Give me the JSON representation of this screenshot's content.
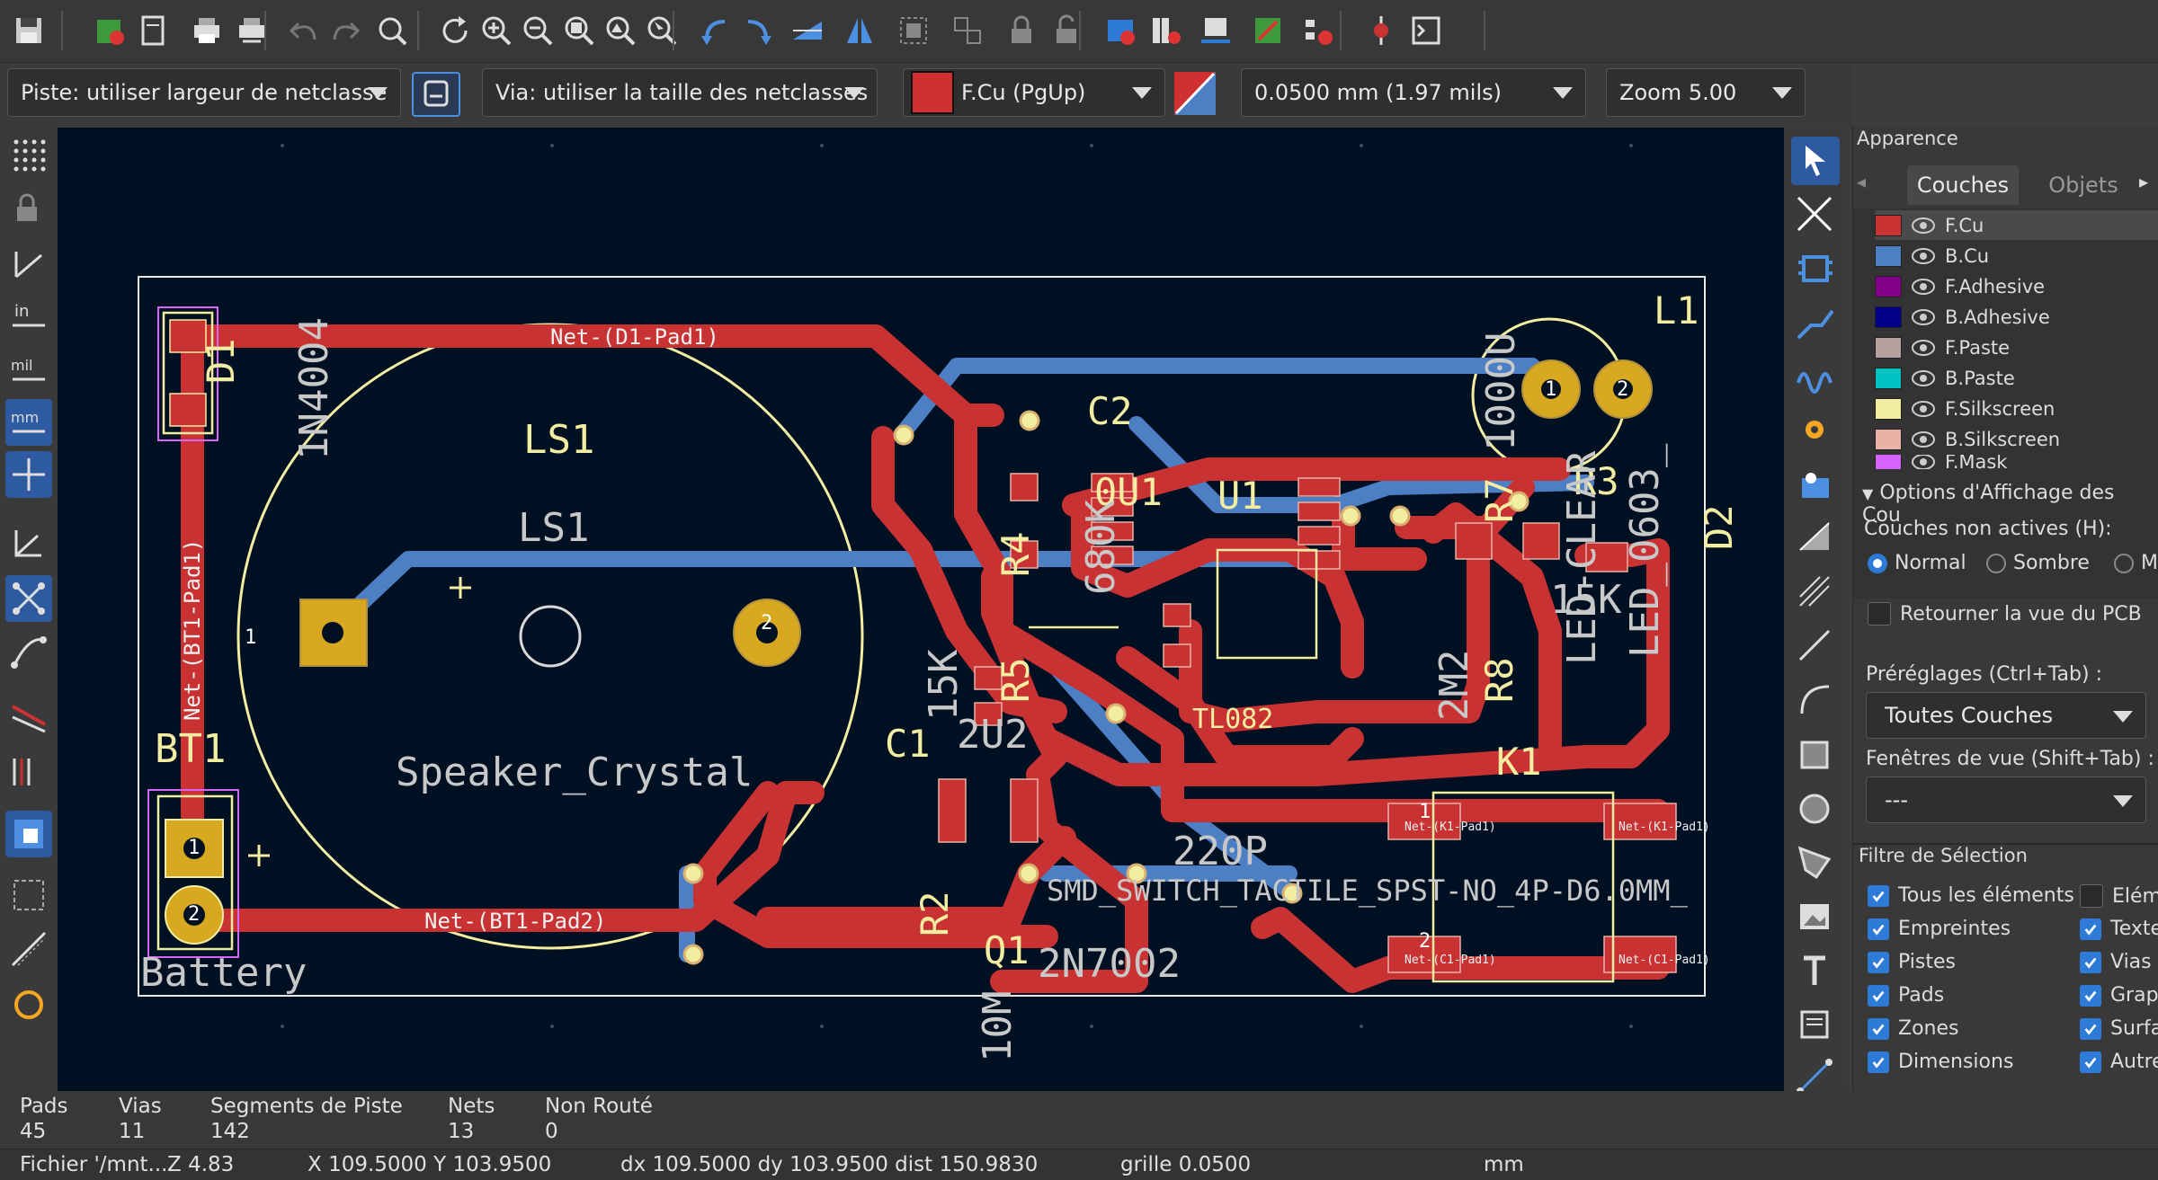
{
  "app": "KiCad PCB Editor",
  "aux_toolbar": {
    "track_width": "Piste: utiliser largeur de netclasse",
    "via_size": "Via: utiliser la taille des netclasses",
    "layer": "F.Cu (PgUp)",
    "grid": "0.0500 mm (1.97 mils)",
    "zoom": "Zoom 5.00",
    "colors": {
      "active_layer": "#d03030",
      "accent": "#2d5aa0"
    }
  },
  "top_toolbar_icons": [
    "save-icon",
    "board-setup-icon",
    "page-settings-icon",
    "print-icon",
    "plot-icon",
    "undo-icon",
    "redo-icon",
    "find-icon",
    "refresh-icon",
    "zoom-in-icon",
    "zoom-out-icon",
    "zoom-fit-icon",
    "zoom-objects-icon",
    "zoom-selection-icon",
    "rotate-ccw-icon",
    "rotate-cw-icon",
    "flip-icon",
    "mirror-icon",
    "group-icon",
    "ungroup-icon",
    "lock-icon",
    "unlock-icon",
    "netlist-icon",
    "footprint-library-icon",
    "footprint-editor-icon",
    "scripting-icon",
    "drc-icon",
    "update-pcb-icon",
    "scripting-console-icon"
  ],
  "left_toolbar_icons": [
    "grid-dots-icon",
    "lock-icon",
    "angle-icon",
    "inch-units-icon",
    "mil-units-icon",
    "mm-units-icon",
    "cursor-crosshair-icon",
    "polar-coords-icon",
    "ratsnest-icon",
    "curved-ratsnest-icon",
    "net-color-icon",
    "layer-colors-icon",
    "high-contrast-icon",
    "outline-zones-icon",
    "tracks-outline-icon",
    "pads-outline-icon"
  ],
  "right_toolbar_icons": [
    "select-icon",
    "highlight-net-icon",
    "footprint-add-icon",
    "route-track-icon",
    "route-diff-pair-icon",
    "tune-length-icon",
    "add-via-icon",
    "add-zone-icon",
    "add-rule-area-icon",
    "draw-line-icon",
    "draw-arc-icon",
    "draw-rectangle-icon",
    "draw-circle-icon",
    "draw-polygon-icon",
    "add-image-icon",
    "add-text-icon",
    "add-textbox-icon",
    "add-dimension-icon"
  ],
  "pcb": {
    "net_labels": {
      "d1": "Net-(D1-Pad1)",
      "bt1_pad2": "Net-(BT1-Pad2)",
      "bt1_pad1": "Net-(BT1-Pad1)",
      "k1_pad1": "Net-(K1-Pad1)",
      "c1_pad1": "Net-(C1-Pad1)"
    },
    "ref_labels": {
      "ls1": "LS1",
      "ls1_back": "LS1",
      "speaker": "Speaker_Crystal",
      "battery": "Battery",
      "bt1": "BT1",
      "d1": "D1",
      "d1_val": "1N4004",
      "c2": "C2",
      "u1": "U1",
      "l1": "L1",
      "r3": "R3",
      "d2": "D2",
      "c1": "C1",
      "k1": "K1",
      "q1": "Q1",
      "tl082": "TL082",
      "q1_val": "2N7002",
      "switch": "SMD_SWITCH_TACTILE_SPST-NO_4P-D6.0MM_",
      "val_15k_a": "15K",
      "val_15k_b": "15K",
      "val_1000u": "1000U",
      "val_0u1": "0U1",
      "val_2m2": "2M2",
      "val_2u2": "2U2",
      "val_220p": "220P",
      "val_10m": "10M",
      "r4": "R4",
      "r5": "R5",
      "r7": "R7",
      "r8": "R8",
      "r2": "R2",
      "led": "LED_0603_",
      "led_clear": "LED-CLEAR",
      "k680": "680K"
    },
    "pad_numbers": [
      "1",
      "2"
    ]
  },
  "panel": {
    "title": "Apparence",
    "tab_layers": "Couches",
    "tab_objects": "Objets",
    "layers": [
      {
        "name": "F.Cu",
        "color": "#c83232"
      },
      {
        "name": "B.Cu",
        "color": "#4d7fc4"
      },
      {
        "name": "F.Adhesive",
        "color": "#84008a"
      },
      {
        "name": "B.Adhesive",
        "color": "#00008a"
      },
      {
        "name": "F.Paste",
        "color": "#b4a09c"
      },
      {
        "name": "B.Paste",
        "color": "#00c2c2"
      },
      {
        "name": "F.Silkscreen",
        "color": "#f2eda1"
      },
      {
        "name": "B.Silkscreen",
        "color": "#e8b2a7"
      },
      {
        "name": "F.Mask",
        "color": "#d864ff"
      }
    ],
    "display_options": "Options d'Affichage des Cou",
    "inactive_layers": "Couches non actives (H):",
    "radio_normal": "Normal",
    "radio_dim": "Sombre",
    "radio_hide": "M",
    "flip_view": "Retourner la vue du PCB",
    "presets_label": "Préréglages (Ctrl+Tab) :",
    "presets_value": "Toutes Couches",
    "viewports_label": "Fenêtres de vue (Shift+Tab) :",
    "viewports_value": "---",
    "selection_filter": "Filtre de Sélection",
    "filters_left": [
      "Tous les éléments",
      "Empreintes",
      "Pistes",
      "Pads",
      "Zones",
      "Dimensions"
    ],
    "filters_right": [
      "Eléme",
      "Texte",
      "Vias",
      "Graph",
      "Surfa",
      "Autre"
    ]
  },
  "stats": {
    "pads_label": "Pads",
    "pads": "45",
    "vias_label": "Vias",
    "vias": "11",
    "segments_label": "Segments de Piste",
    "segments": "142",
    "nets_label": "Nets",
    "nets": "13",
    "unrouted_label": "Non Routé",
    "unrouted": "0"
  },
  "status": {
    "file": "Fichier '/mnt...",
    "z": "Z 4.83",
    "xy": "X 109.5000  Y 103.9500",
    "dxdy": "dx 109.5000  dy 103.9500  dist 150.9830",
    "grid": "grille 0.0500",
    "units": "mm"
  }
}
